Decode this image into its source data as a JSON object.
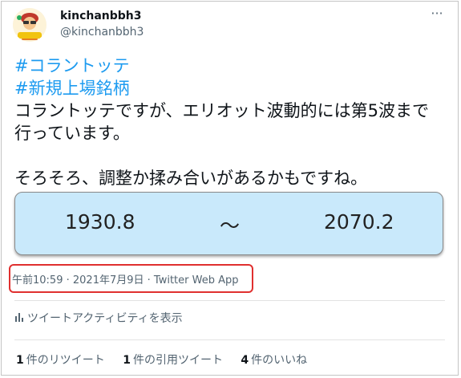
{
  "user": {
    "display_name": "kinchanbbh3",
    "handle": "@kinchanbbh3",
    "more_label": "···"
  },
  "tweet": {
    "hashtags": [
      "#コラントッテ",
      "#新規上場銘柄"
    ],
    "body_line1": "コラントッテですが、エリオット波動的には第5波まで",
    "body_line2": "行っています。",
    "body_line3": "そろそろ、調整か揉み合いがあるかもですね。"
  },
  "media": {
    "value_low": "1930.8",
    "separator": "～",
    "value_high": "2070.2",
    "background_color": "#c9e9fb"
  },
  "meta": {
    "time": "午前10:59",
    "date": "2021年7月9日",
    "source": "Twitter Web App",
    "dot": " · ",
    "highlight_color": "#e0302f"
  },
  "activity": {
    "icon": "bar-chart-icon",
    "label": "ツイートアクティビティを表示"
  },
  "stats": [
    {
      "count": "1",
      "label": "件のリツイート"
    },
    {
      "count": "1",
      "label": "件の引用ツイート"
    },
    {
      "count": "4",
      "label": "件のいいね"
    }
  ]
}
